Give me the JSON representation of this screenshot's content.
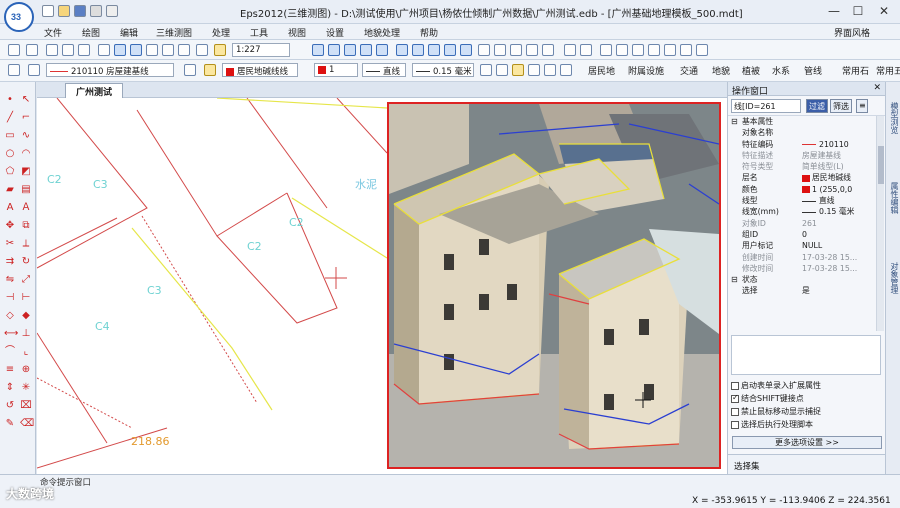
{
  "app": {
    "logo_text": "33",
    "title": "Eps2012(三维测图) - D:\\测试使用\\广州项目\\杨侬仕倾制广州数据\\广州测试.edb - [广州基础地理模板_500.mdt]"
  },
  "window_controls": {
    "minimize": "—",
    "maximize": "☐",
    "close": "✕"
  },
  "menu": {
    "items": [
      "文件",
      "绘图",
      "编辑",
      "三维测图",
      "处理",
      "工具",
      "视图",
      "设置",
      "地貌处理",
      "帮助"
    ],
    "style_label": "界面风格"
  },
  "toolbar1": {
    "scale": "1:227"
  },
  "toolbar2": {
    "line_code": "210110 房屋建基线",
    "layer": "居民地碱线线",
    "color_index": "1",
    "linetype": "直线",
    "linewidth": "0.15 毫米",
    "categories": [
      "居民地",
      "附属设施",
      "交通",
      "地貌",
      "植被",
      "水系",
      "管线",
      "常用石",
      "常用五"
    ]
  },
  "document": {
    "tab": "广州测试"
  },
  "canvas": {
    "labels": [
      "C2",
      "C3",
      "C2",
      "C4",
      "C3",
      "C2",
      "水泥"
    ],
    "elevation": "218.86"
  },
  "property_panel": {
    "header": "操作窗口",
    "selector": "线[ID=261",
    "btn_filter": "过滤",
    "btn_query": "筛选",
    "sections": {
      "basic": "基本属性",
      "state": "状态"
    },
    "rows": [
      {
        "name": "对象名称",
        "value": ""
      },
      {
        "name": "特征编码",
        "value": "210110"
      },
      {
        "name": "特征描述",
        "value": "房屋建基线"
      },
      {
        "name": "符号类型",
        "value": "简单线型(L)"
      },
      {
        "name": "层名",
        "value": "居民地碱线"
      },
      {
        "name": "颜色",
        "value": "1 (255,0,0"
      },
      {
        "name": "线型",
        "value": "直线"
      },
      {
        "name": "线宽(mm)",
        "value": "0.15 毫米"
      },
      {
        "name": "对象ID",
        "value": "261"
      },
      {
        "name": "组ID",
        "value": "0"
      },
      {
        "name": "用户标记",
        "value": "NULL"
      },
      {
        "name": "创建时间",
        "value": "17-03-28 15..."
      },
      {
        "name": "修改时间",
        "value": "17-03-28 15..."
      }
    ],
    "state_rows": [
      {
        "name": "选择",
        "value": "是"
      }
    ],
    "checkboxes": [
      {
        "label": "启动表单录入扩展属性",
        "checked": false
      },
      {
        "label": "结合SHIFT键接点",
        "checked": true
      },
      {
        "label": "禁止鼠标移动显示捕捉",
        "checked": false
      },
      {
        "label": "选择后执行处理脚本",
        "checked": false
      }
    ],
    "more_button": "更多选项设置 >>",
    "footer_tab": "选择集"
  },
  "side_tabs": [
    "模型浏览",
    "属性编辑",
    "对象管理"
  ],
  "bottom": {
    "cmd_tab": "命令提示窗口",
    "coords": "X = -353.9615  Y = -113.9406  Z = 224.3561",
    "watermark": "大数跨境"
  },
  "colors": {
    "accent": "#3b5ea8",
    "cad_red": "#d33333",
    "cad_yellow": "#e6e64a",
    "label_cyan": "#6fd2d2",
    "photo_border": "#dd2222"
  }
}
